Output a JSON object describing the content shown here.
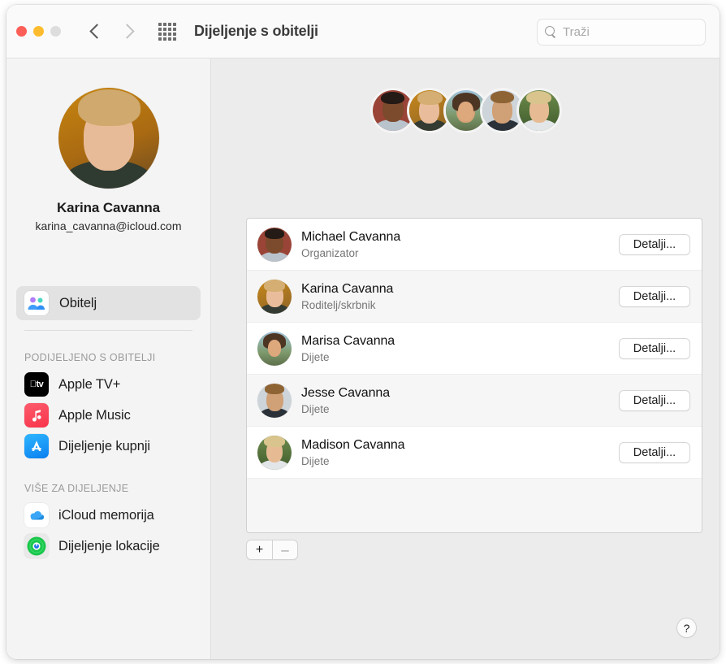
{
  "window": {
    "title": "Dijeljenje s obitelji",
    "traffic_lights": [
      "close",
      "minimize",
      "zoom-disabled"
    ],
    "nav": {
      "back_icon": "chevron-left-icon",
      "forward_icon": "chevron-right-icon",
      "grid_icon": "grid-view-icon"
    },
    "search": {
      "placeholder": "Traži",
      "icon": "search-icon"
    }
  },
  "sidebar": {
    "profile": {
      "name": "Karina Cavanna",
      "email": "karina_cavanna@icloud.com",
      "avatar": "karina-portrait"
    },
    "selected_item": {
      "label": "Obitelj",
      "icon": "family-group-icon"
    },
    "sections": [
      {
        "title": "PODIJELJENO S OBITELJI",
        "items": [
          {
            "label": "Apple TV+",
            "icon": "apple-tv-icon",
            "glyph": "tv"
          },
          {
            "label": "Apple Music",
            "icon": "apple-music-icon",
            "glyph": "music-note"
          },
          {
            "label": "Dijeljenje kupnji",
            "icon": "app-store-icon",
            "glyph": "app-store-a"
          }
        ]
      },
      {
        "title": "VIŠE ZA DIJELJENJE",
        "items": [
          {
            "label": "iCloud memorija",
            "icon": "icloud-icon",
            "glyph": "cloud"
          },
          {
            "label": "Dijeljenje lokacije",
            "icon": "find-my-icon",
            "glyph": "radar"
          }
        ]
      }
    ]
  },
  "main": {
    "title": "Dijeljenje s obitelji",
    "avatar_stack": [
      "michael",
      "karina",
      "marisa",
      "jesse",
      "madison"
    ],
    "members": [
      {
        "name": "Michael Cavanna",
        "role": "Organizator",
        "button": "Detalji...",
        "avatar": "michael"
      },
      {
        "name": "Karina Cavanna",
        "role": "Roditelj/skrbnik",
        "button": "Detalji...",
        "avatar": "karina"
      },
      {
        "name": "Marisa Cavanna",
        "role": "Dijete",
        "button": "Detalji...",
        "avatar": "marisa"
      },
      {
        "name": "Jesse Cavanna",
        "role": "Dijete",
        "button": "Detalji...",
        "avatar": "jesse"
      },
      {
        "name": "Madison Cavanna",
        "role": "Dijete",
        "button": "Detalji...",
        "avatar": "madison"
      }
    ],
    "add_button": "+",
    "remove_button": "–",
    "help_button": "?"
  },
  "colors": {
    "window_bg": "#ececec",
    "sidebar_bg": "#f4f4f4",
    "toolbar_bg": "#fafafa",
    "list_bg": "#ffffff",
    "list_alt_row": "#f6f6f6",
    "text_primary": "#1d1d1d",
    "text_secondary": "#767676",
    "close_red": "#fc5f57",
    "minimize_yellow": "#fdbc2e",
    "zoom_gray": "#dddddd"
  }
}
